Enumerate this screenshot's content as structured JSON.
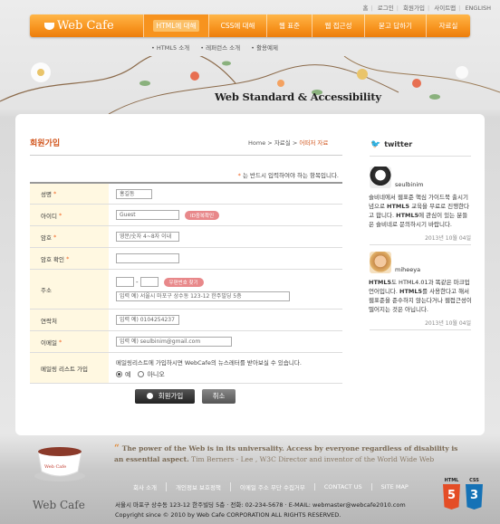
{
  "util_nav": [
    "홈",
    "로그인",
    "회원가입",
    "사이트맵",
    "ENGLISH"
  ],
  "logo": "Web Cafe",
  "gnb": [
    "HTML에 대해",
    "CSS에 대해",
    "웹 표준",
    "웹 접근성",
    "묻고 답하기",
    "자료실"
  ],
  "sub_nav": [
    "• HTML5 소개",
    "• 레퍼런스 소개",
    "• 활용예제"
  ],
  "banner_title": "Web Standard & Accessibility",
  "page_title": "회원가입",
  "breadcrumb": {
    "home": "Home",
    "sep1": ">",
    "section": "자료실",
    "sep2": ">",
    "current": "어떠저 자료"
  },
  "required_note": "는 반드시 입력하여야 하는 항목입니다.",
  "form": {
    "name_label": "성명",
    "name_value": "홍길동",
    "id_label": "아이디",
    "id_value": "Guest",
    "id_check": "ID중복확인",
    "pw_label": "암호",
    "pw_placeholder": "영문/숫자 4~8자 이내",
    "pw2_label": "암호 확인",
    "addr_label": "주소",
    "zip_btn": "우편번호 찾기",
    "addr_placeholder": "입력 예) 서울시 마포구 상수동 123-12 한주빌딩 5층",
    "phone_label": "연락처",
    "phone_placeholder": "입력 예) 0104254237",
    "email_label": "이메일",
    "email_placeholder": "입력 예) seulbinim@gmail.com",
    "mail_label": "메일링 리스트 가입",
    "mail_desc": "메일링리스트에 가입하시면 WebCafe의 뉴스레터를 받아보실 수 있습니다.",
    "radio_yes": "예",
    "radio_no": "아니오"
  },
  "buttons": {
    "join": "회원가입",
    "cancel": "취소"
  },
  "twitter": {
    "title": "twitter",
    "tweets": [
      {
        "user": "seulbinim",
        "text_parts": [
          "슬비네에서 웹표준 핵심 가이드북 출시기념으로 ",
          "HTML5",
          " 교육을 무료로 진행한다고 합니다. ",
          "HTML5",
          "에 관심이 있는 분들은 슬비네로 문의하시기 바랍니다."
        ],
        "date": "2013년 10월 04일"
      },
      {
        "user": "miheeya",
        "text_parts": [
          "HTML5",
          "도 HTML4.01과 똑같은 마크업 언어입니다. ",
          "HTML5",
          "를 사용한다고 해서 웹표준을 준수하지 않는다거나 웹접근성이 떨어지는 것은 아닙니다."
        ],
        "date": "2013년 10월 04일"
      }
    ]
  },
  "quote": {
    "text": "The power of the Web is in its universality. Access by everyone regardless of disability is an essential aspect.",
    "author": "Tim Berners - Lee , W3C Director and inventor of the World Wide Web"
  },
  "footer_menu": [
    "회사 소개",
    "개인정보 보호정책",
    "이메일 주소 무단 수집거부",
    "CONTACT US",
    "SITE MAP"
  ],
  "footer_logo": "Web Cafe",
  "footer_cup_label": "Web Cafe",
  "address": "서울시 마포구 상수동 123-12 한주빌딩 5층   · 전화: 02-234-5678   · E-MAIL: webmaster@webcafe2010.com",
  "copyright": "Copyright since © 2010 by Web Cafe CORPORATION ALL RIGHTS RESERVED.",
  "badges": [
    {
      "label": "HTML",
      "num": "5",
      "color": "#e44d26"
    },
    {
      "label": "CSS",
      "num": "3",
      "color": "#1572b6"
    }
  ]
}
